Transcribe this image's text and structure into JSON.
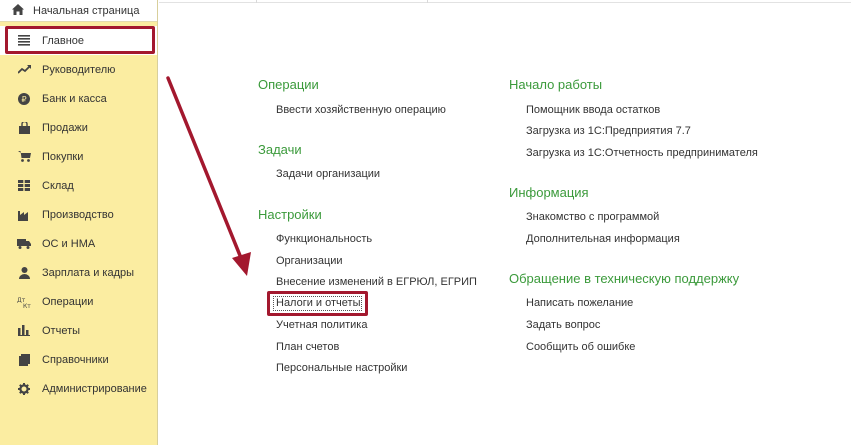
{
  "sidebar": {
    "home_label": "Начальная страница",
    "home_icon": "home-icon",
    "items": [
      {
        "label": "Главное",
        "icon": "menu-lines-icon",
        "active": true
      },
      {
        "label": "Руководителю",
        "icon": "trend-up-icon"
      },
      {
        "label": "Банк и касса",
        "icon": "ruble-coin-icon"
      },
      {
        "label": "Продажи",
        "icon": "shopping-bag-icon"
      },
      {
        "label": "Покупки",
        "icon": "shopping-cart-icon"
      },
      {
        "label": "Склад",
        "icon": "warehouse-grid-icon"
      },
      {
        "label": "Производство",
        "icon": "factory-icon"
      },
      {
        "label": "ОС и НМА",
        "icon": "truck-icon"
      },
      {
        "label": "Зарплата и кадры",
        "icon": "person-icon"
      },
      {
        "label": "Операции",
        "icon": "dt-kt-icon"
      },
      {
        "label": "Отчеты",
        "icon": "bar-chart-icon"
      },
      {
        "label": "Справочники",
        "icon": "book-icon"
      },
      {
        "label": "Администрирование",
        "icon": "gear-icon"
      }
    ]
  },
  "colors": {
    "sidebar_bg": "#fbeda1",
    "section_title": "#3b9a3b",
    "highlight": "#a3182e"
  },
  "content": {
    "left": {
      "operations": {
        "title": "Операции",
        "links": [
          "Ввести хозяйственную операцию"
        ]
      },
      "tasks": {
        "title": "Задачи",
        "links": [
          "Задачи организации"
        ]
      },
      "settings": {
        "title": "Настройки",
        "links": [
          "Функциональность",
          "Организации",
          "Внесение изменений в ЕГРЮЛ, ЕГРИП",
          "Налоги и отчеты",
          "Учетная политика",
          "План счетов",
          "Персональные настройки"
        ]
      }
    },
    "right": {
      "start": {
        "title": "Начало работы",
        "links": [
          "Помощник ввода остатков",
          "Загрузка из 1С:Предприятия 7.7",
          "Загрузка из 1С:Отчетность предпринимателя"
        ]
      },
      "info": {
        "title": "Информация",
        "links": [
          "Знакомство с программой",
          "Дополнительная информация"
        ]
      },
      "support": {
        "title": "Обращение в техническую поддержку",
        "links": [
          "Написать пожелание",
          "Задать вопрос",
          "Сообщить об ошибке"
        ]
      }
    }
  }
}
